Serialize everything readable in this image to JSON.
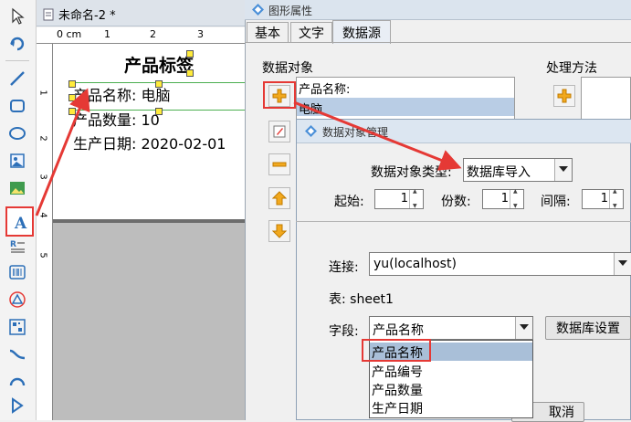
{
  "document": {
    "tab_title": "未命名-2 *",
    "ruler_unit": "0 cm",
    "ruler_ticks": [
      "1",
      "2",
      "3"
    ],
    "vruler_ticks": [
      "1",
      "2",
      "3",
      "4",
      "5"
    ],
    "label": {
      "title": "产品标签",
      "line1": "产品名称: 电脑",
      "line2": "产品数量: 10",
      "line3": "生产日期: 2020-02-01"
    }
  },
  "properties_dialog": {
    "title": "图形属性",
    "tabs": [
      "基本",
      "文字",
      "数据源"
    ],
    "data_object_label": "数据对象",
    "processing_label": "处理方法",
    "data_items": [
      "产品名称:",
      "电脑"
    ]
  },
  "data_manager": {
    "title": "数据对象管理",
    "type_label": "数据对象类型:",
    "type_value": "数据库导入",
    "start_label": "起始:",
    "start_value": "1",
    "copies_label": "份数:",
    "copies_value": "1",
    "interval_label": "间隔:",
    "interval_value": "1",
    "connection_label": "连接:",
    "connection_value": "yu(localhost)",
    "table_label": "表: sheet1",
    "field_label": "字段:",
    "field_value": "产品名称",
    "db_settings_button": "数据库设置",
    "field_options": [
      "产品名称",
      "产品编号",
      "产品数量",
      "生产日期"
    ],
    "cancel_button": "取消"
  },
  "colors": {
    "highlight_red": "#e53935",
    "selection_blue": "#b9cde5",
    "option_selected": "#a9bfd8"
  }
}
